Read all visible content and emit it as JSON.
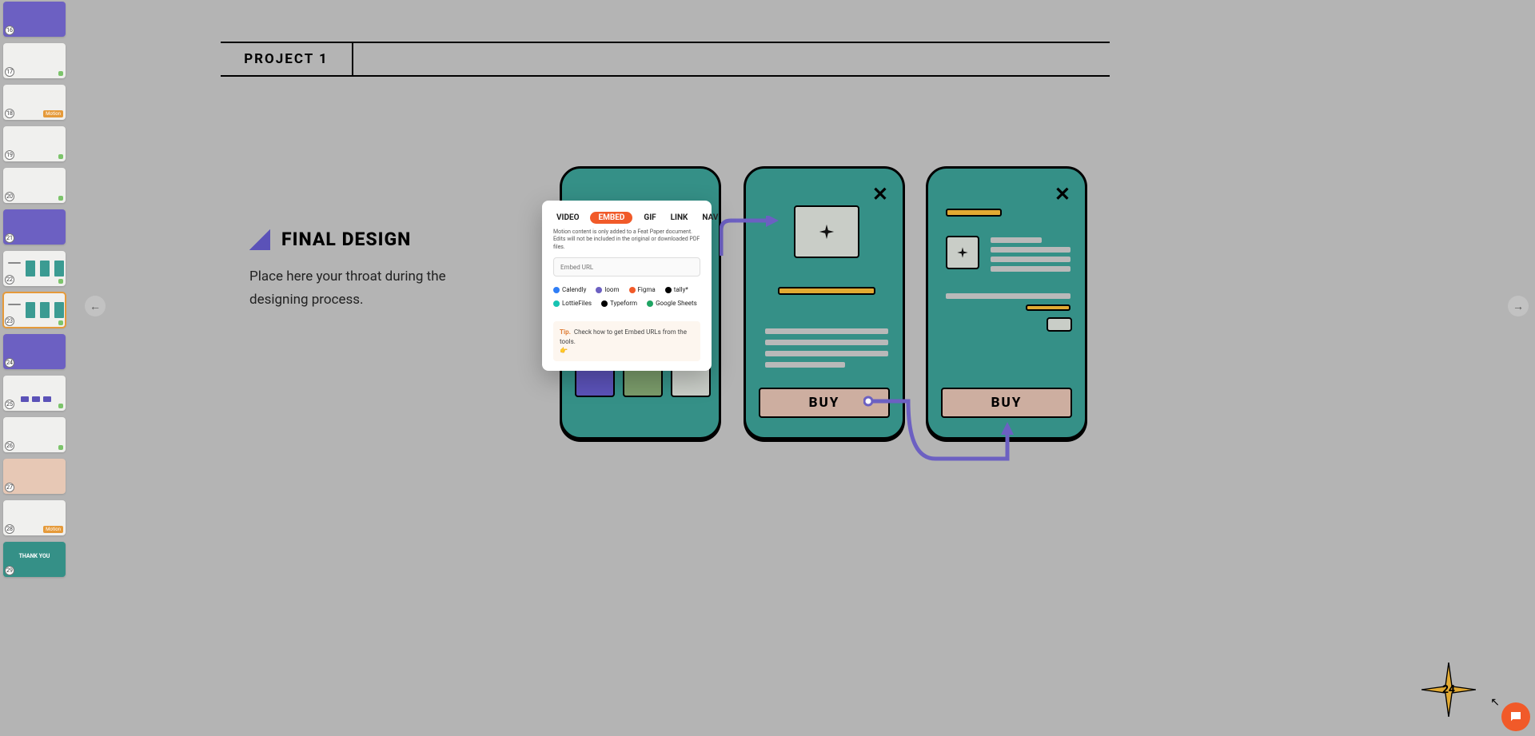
{
  "sidebar": {
    "slides": [
      {
        "num": "16",
        "variant": "teal"
      },
      {
        "num": "17",
        "variant": "light",
        "dot": true
      },
      {
        "num": "18",
        "variant": "light",
        "badge": "Motion"
      },
      {
        "num": "19",
        "variant": "light",
        "dot": true
      },
      {
        "num": "20",
        "variant": "light",
        "dot": true
      },
      {
        "num": "21",
        "variant": "teal"
      },
      {
        "num": "22",
        "variant": "light",
        "dot": true,
        "miniPhones": true
      },
      {
        "num": "23",
        "variant": "light",
        "dot": true,
        "selected": true,
        "miniPhones": true
      },
      {
        "num": "24",
        "variant": "teal"
      },
      {
        "num": "25",
        "variant": "light",
        "dot": true,
        "miniBars": true
      },
      {
        "num": "26",
        "variant": "light",
        "dot": true
      },
      {
        "num": "27",
        "variant": "pink"
      },
      {
        "num": "28",
        "variant": "light",
        "badge": "Motion"
      },
      {
        "num": "29",
        "variant": "green",
        "label": "THANK YOU"
      }
    ]
  },
  "slide": {
    "project_label": "PROJECT 1",
    "heading": "FINAL DESIGN",
    "body": "Place here your throat during the designing process.",
    "page_number": "24"
  },
  "phones": {
    "buy_label": "BUY"
  },
  "popup": {
    "tabs": [
      "VIDEO",
      "EMBED",
      "GIF",
      "LINK",
      "NAV"
    ],
    "active_tab": "EMBED",
    "note_line1": "Motion content is only added to a Feat Paper document.",
    "note_line2": "Edits will not be included in the original or downloaded PDF files.",
    "input_placeholder": "Embed URL",
    "logos": [
      {
        "name": "Calendly",
        "color": "#2f7ef6"
      },
      {
        "name": "loom",
        "color": "#6c60c2"
      },
      {
        "name": "Figma",
        "color": "#f15a29"
      },
      {
        "name": "tally*",
        "color": "#000"
      },
      {
        "name": "LottieFiles",
        "color": "#17c3b2"
      },
      {
        "name": "Typeform",
        "color": "#000"
      },
      {
        "name": "Google Sheets",
        "color": "#1fa463"
      }
    ],
    "tip_label": "Tip.",
    "tip_text": "Check how to get Embed URLs from the tools.",
    "tip_emoji": "👉"
  },
  "nav": {
    "prev": "←",
    "next": "→"
  }
}
